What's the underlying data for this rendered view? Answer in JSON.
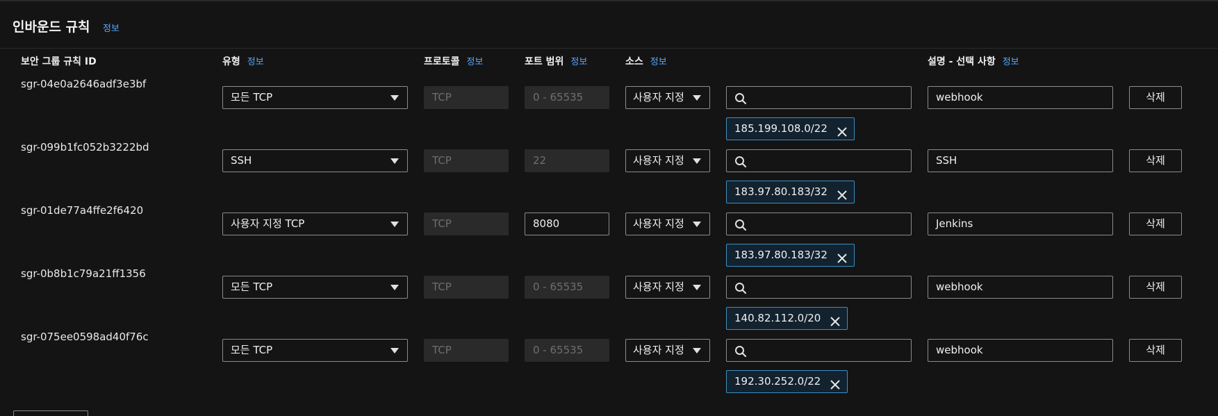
{
  "panel": {
    "title": "인바운드 규칙",
    "info_link": "정보"
  },
  "columns": {
    "rule_id": "보안 그룹 규칙 ID",
    "type": "유형",
    "protocol": "프로토콜",
    "port_range": "포트 범위",
    "source": "소스",
    "description": "설명 - 선택 사항",
    "info_link": "정보"
  },
  "icons": {
    "search": "search-icon",
    "remove": "close-icon",
    "dropdown": "caret-down-icon"
  },
  "rules": [
    {
      "id": "sgr-04e0a2646adf3e3bf",
      "type": "모든 TCP",
      "protocol": "TCP",
      "port": "0 - 65535",
      "port_editable": false,
      "source_type": "사용자 지정",
      "cidr": "185.199.108.0/22",
      "description": "webhook",
      "delete_label": "삭제"
    },
    {
      "id": "sgr-099b1fc052b3222bd",
      "type": "SSH",
      "protocol": "TCP",
      "port": "22",
      "port_editable": false,
      "source_type": "사용자 지정",
      "cidr": "183.97.80.183/32",
      "description": "SSH",
      "delete_label": "삭제"
    },
    {
      "id": "sgr-01de77a4ffe2f6420",
      "type": "사용자 지정 TCP",
      "protocol": "TCP",
      "port": "8080",
      "port_editable": true,
      "source_type": "사용자 지정",
      "cidr": "183.97.80.183/32",
      "description": "Jenkins",
      "delete_label": "삭제"
    },
    {
      "id": "sgr-0b8b1c79a21ff1356",
      "type": "모든 TCP",
      "protocol": "TCP",
      "port": "0 - 65535",
      "port_editable": false,
      "source_type": "사용자 지정",
      "cidr": "140.82.112.0/20",
      "description": "webhook",
      "delete_label": "삭제"
    },
    {
      "id": "sgr-075ee0598ad40f76c",
      "type": "모든 TCP",
      "protocol": "TCP",
      "port": "0 - 65535",
      "port_editable": false,
      "source_type": "사용자 지정",
      "cidr": "192.30.252.0/22",
      "description": "webhook",
      "delete_label": "삭제"
    }
  ],
  "colors": {
    "background": "#141414",
    "link": "#57a8ff",
    "token_border": "#3d8fc4"
  }
}
